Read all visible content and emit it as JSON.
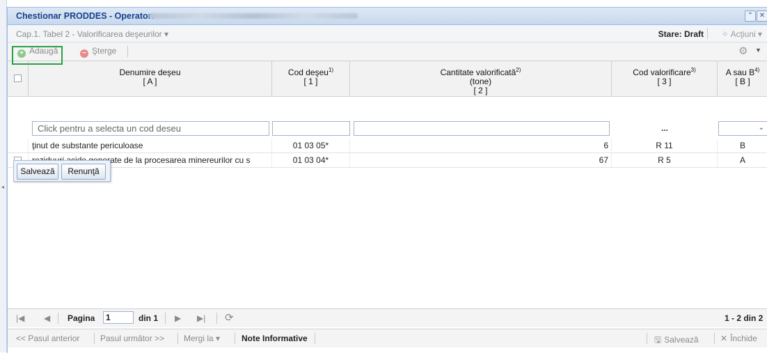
{
  "window": {
    "title": "Chestionar PRODDES - Operator:",
    "operator_name_obscured": ""
  },
  "subbar": {
    "breadcrumb": "Cap.1. Tabel 2 - Valorificarea deşeurilor ▾",
    "state": "Stare: Draft",
    "actions": "Acţiuni ▾"
  },
  "toolbar": {
    "add_label": "Adaugă",
    "delete_label": "Şterge"
  },
  "grid": {
    "columns": [
      {
        "label": "Denumire deşeu",
        "sup": "",
        "sub1": "[ A ]",
        "sub2": ""
      },
      {
        "label": "Cod deşeu",
        "sup": "1)",
        "sub1": "[ 1 ]",
        "sub2": ""
      },
      {
        "label": "Cantitate valorificată",
        "sup": "2)",
        "sub1": "(tone)",
        "sub2": "[ 2 ]"
      },
      {
        "label": "Cod valorificare",
        "sup": "3)",
        "sub1": "[ 3 ]",
        "sub2": ""
      },
      {
        "label": "A sau B",
        "sup": "4)",
        "sub1": "[ B ]",
        "sub2": ""
      }
    ],
    "editor": {
      "name_placeholder": "Click pentru a selecta un cod deseu",
      "cod_valorificare_value": "...",
      "save_label": "Salvează",
      "cancel_label": "Renunţă"
    },
    "rows": [
      {
        "name": "ţinut de substante periculoase",
        "cod": "01 03 05*",
        "cantitate": "6",
        "cod_val": "R 11",
        "ab": "B"
      },
      {
        "name": "reziduuri acide generate de la procesarea minereurilor cu s",
        "cod": "01 03 04*",
        "cantitate": "67",
        "cod_val": "R 5",
        "ab": "A"
      }
    ]
  },
  "pager": {
    "page_label": "Pagina",
    "page_value": "1",
    "of_label": "din 1",
    "summary": "1 - 2 din 2"
  },
  "footer": {
    "prev": "<< Pasul anterior",
    "next": "Pasul următor >>",
    "goto": "Mergi la ▾",
    "notes": "Note Informative",
    "save": "Salvează",
    "close": "Închide"
  }
}
